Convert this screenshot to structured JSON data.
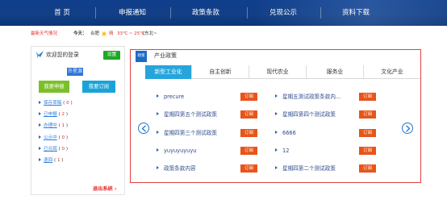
{
  "nav": {
    "items": [
      "首 页",
      "申报通知",
      "政策条款",
      "兑现公示",
      "资料下载"
    ]
  },
  "weather": {
    "lead": "最新天气情况",
    "today": "今天：",
    "city": "合肥",
    "condition": "晴",
    "temperature": "33℃ ~ 25℃",
    "wind": "(东北~"
  },
  "left_panel": {
    "welcome": "欢迎您的登录",
    "login_button": "设置",
    "username": "许星源",
    "apply_button": "我要申报",
    "subscribe_button": "我要订阅",
    "status_items": [
      {
        "label": "保存草稿",
        "count": "0"
      },
      {
        "label": "已申报",
        "count": "2"
      },
      {
        "label": "办理中",
        "count": "1"
      },
      {
        "label": "公示中",
        "count": "0"
      },
      {
        "label": "已兑现",
        "count": "0"
      },
      {
        "label": "退回",
        "count": "1"
      }
    ],
    "logout": "退出系统 ›"
  },
  "policy": {
    "icon_text": "政策",
    "title": "产业政策",
    "tabs": [
      "新型工业化",
      "自主创新",
      "现代农业",
      "服务业",
      "文化产业"
    ],
    "active_tab": 0,
    "subscribe_label": "订阅",
    "items_left": [
      "precure",
      "星期四第五个测试政策",
      "星期四第三个测试政策",
      "yuyuyuyuyu",
      "政策条款内容"
    ],
    "items_right": [
      "星期五测试政策条款内...",
      "星期四第四个测试政策",
      "6666",
      "12",
      "星期四第二个测试政策"
    ]
  },
  "colors": {
    "nav_bg": "#123f86",
    "tab_active": "#26a5dc",
    "subscribe": "#e85419",
    "login_green": "#1fa826",
    "apply_green": "#7bc02a",
    "panel_border": "#e24244"
  }
}
